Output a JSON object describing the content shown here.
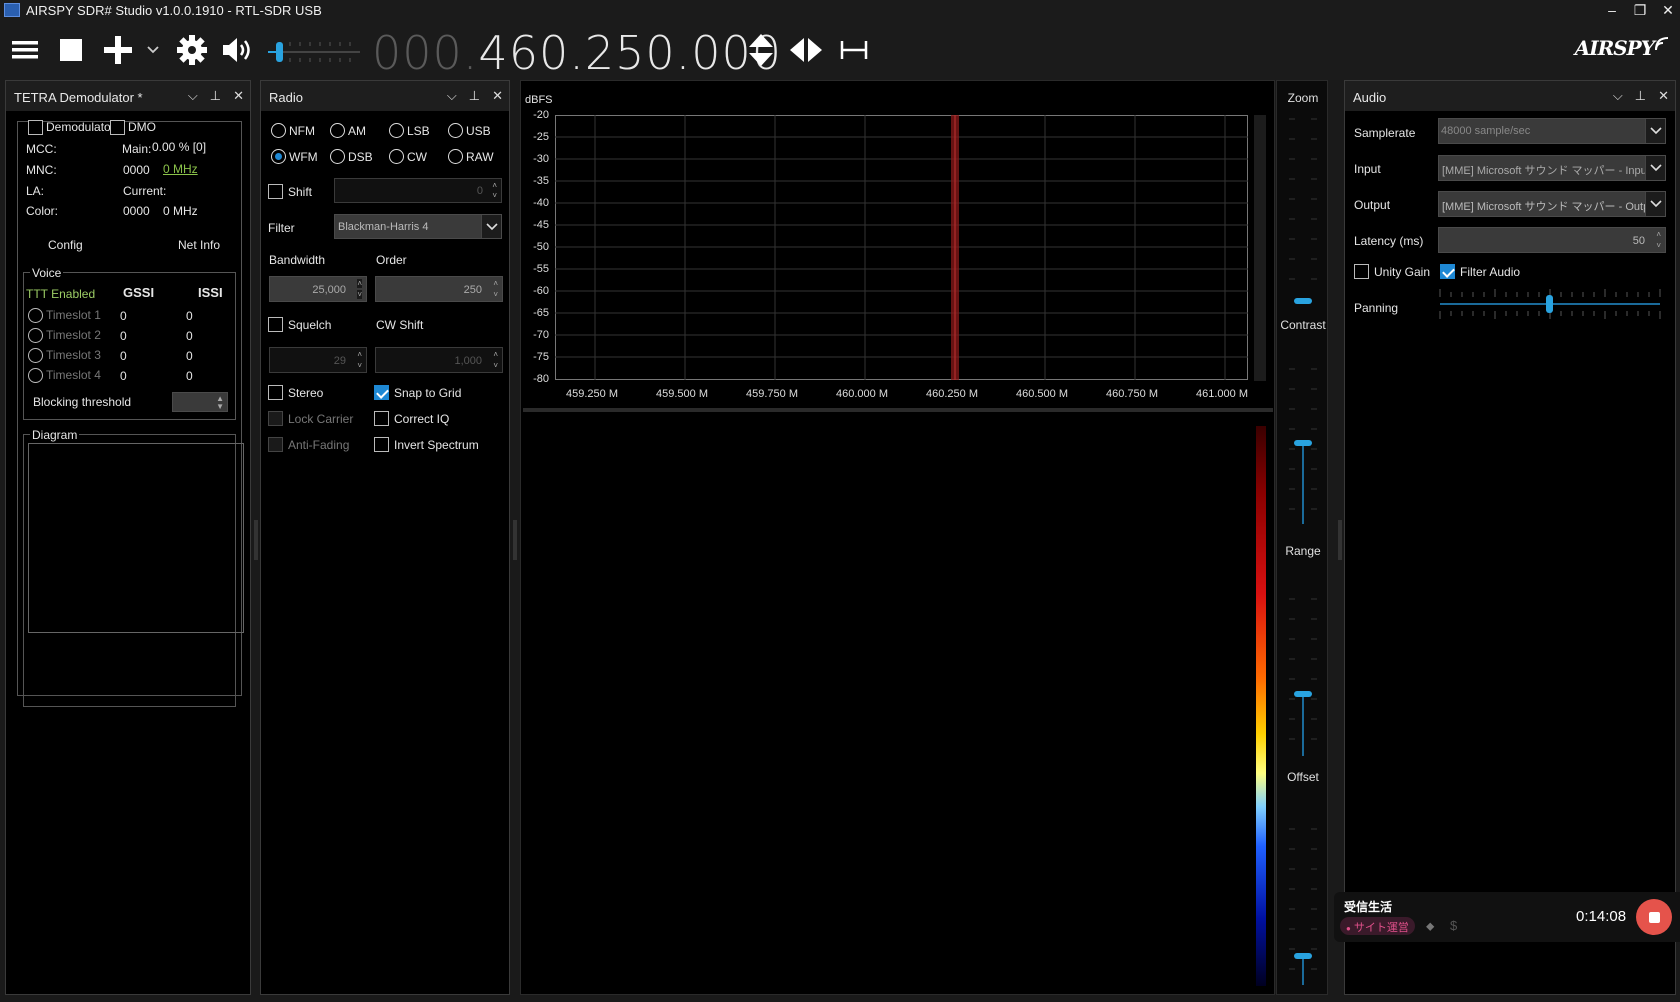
{
  "window": {
    "title": "AIRSPY SDR# Studio v1.0.0.1910 - RTL-SDR USB",
    "minimize": "–",
    "restore": "❐",
    "close": "✕"
  },
  "toolbar": {
    "freq_dim": "000.",
    "freq_lit": "460.250.000",
    "logo": "AIRSPY"
  },
  "colors": {
    "accent": "#1e88d4",
    "panel_bg": "#000000",
    "header_bg": "#1e1e1e",
    "green_text": "#9ccc65"
  },
  "tetra": {
    "title": "TETRA Demodulator *",
    "demodulator_label": "Demodulator",
    "dmo_label": "DMO",
    "mcc_label": "MCC:",
    "main_label": "Main:",
    "main_value": "0.00 % [0]",
    "mnc_label": "MNC:",
    "mnc_value": "0000",
    "mnc_freq": "0 MHz",
    "la_label": "LA:",
    "current_label": "Current:",
    "color_label": "Color:",
    "color_value": "0000",
    "color_freq": "0 MHz",
    "config_label": "Config",
    "netinfo_label": "Net Info",
    "voice_label": "Voice",
    "ttt_label": "TTT Enabled",
    "gssi_header": "GSSI",
    "issi_header": "ISSI",
    "timeslots": [
      {
        "name": "Timeslot 1",
        "gssi": "0",
        "issi": "0"
      },
      {
        "name": "Timeslot 2",
        "gssi": "0",
        "issi": "0"
      },
      {
        "name": "Timeslot 3",
        "gssi": "0",
        "issi": "0"
      },
      {
        "name": "Timeslot 4",
        "gssi": "0",
        "issi": "0"
      }
    ],
    "blocking_label": "Blocking threshold",
    "diagram_label": "Diagram"
  },
  "radio": {
    "title": "Radio",
    "modes": [
      "NFM",
      "AM",
      "LSB",
      "USB",
      "WFM",
      "DSB",
      "CW",
      "RAW"
    ],
    "selected_mode": "WFM",
    "shift_label": "Shift",
    "shift_value": "0",
    "filter_label": "Filter",
    "filter_value": "Blackman-Harris 4",
    "bandwidth_label": "Bandwidth",
    "bandwidth_value": "25,000",
    "order_label": "Order",
    "order_value": "250",
    "squelch_label": "Squelch",
    "squelch_value": "29",
    "cwshift_label": "CW Shift",
    "cwshift_value": "1,000",
    "stereo_label": "Stereo",
    "snap_label": "Snap to Grid",
    "lock_label": "Lock Carrier",
    "correct_label": "Correct IQ",
    "antifading_label": "Anti-Fading",
    "invert_label": "Invert Spectrum"
  },
  "spectrum": {
    "unit": "dBFS",
    "y_ticks": [
      "-20",
      "-25",
      "-30",
      "-35",
      "-40",
      "-45",
      "-50",
      "-55",
      "-60",
      "-65",
      "-70",
      "-75",
      "-80"
    ],
    "x_ticks": [
      "459.250 M",
      "459.500 M",
      "459.750 M",
      "460.000 M",
      "460.250 M",
      "460.500 M",
      "460.750 M",
      "461.000 M"
    ]
  },
  "sliders": {
    "zoom": "Zoom",
    "contrast": "Contrast",
    "range": "Range",
    "offset": "Offset"
  },
  "audio": {
    "title": "Audio",
    "samplerate_label": "Samplerate",
    "samplerate_value": "48000 sample/sec",
    "input_label": "Input",
    "input_value": "[MME] Microsoft サウンド マッパー - Input",
    "output_label": "Output",
    "output_value": "[MME] Microsoft サウンド マッパー - Outp",
    "latency_label": "Latency (ms)",
    "latency_value": "50",
    "unity_label": "Unity Gain",
    "filter_label": "Filter Audio",
    "panning_label": "Panning"
  },
  "notification": {
    "title": "受信生活",
    "tag": "サイト運営",
    "time": "0:14:08"
  }
}
